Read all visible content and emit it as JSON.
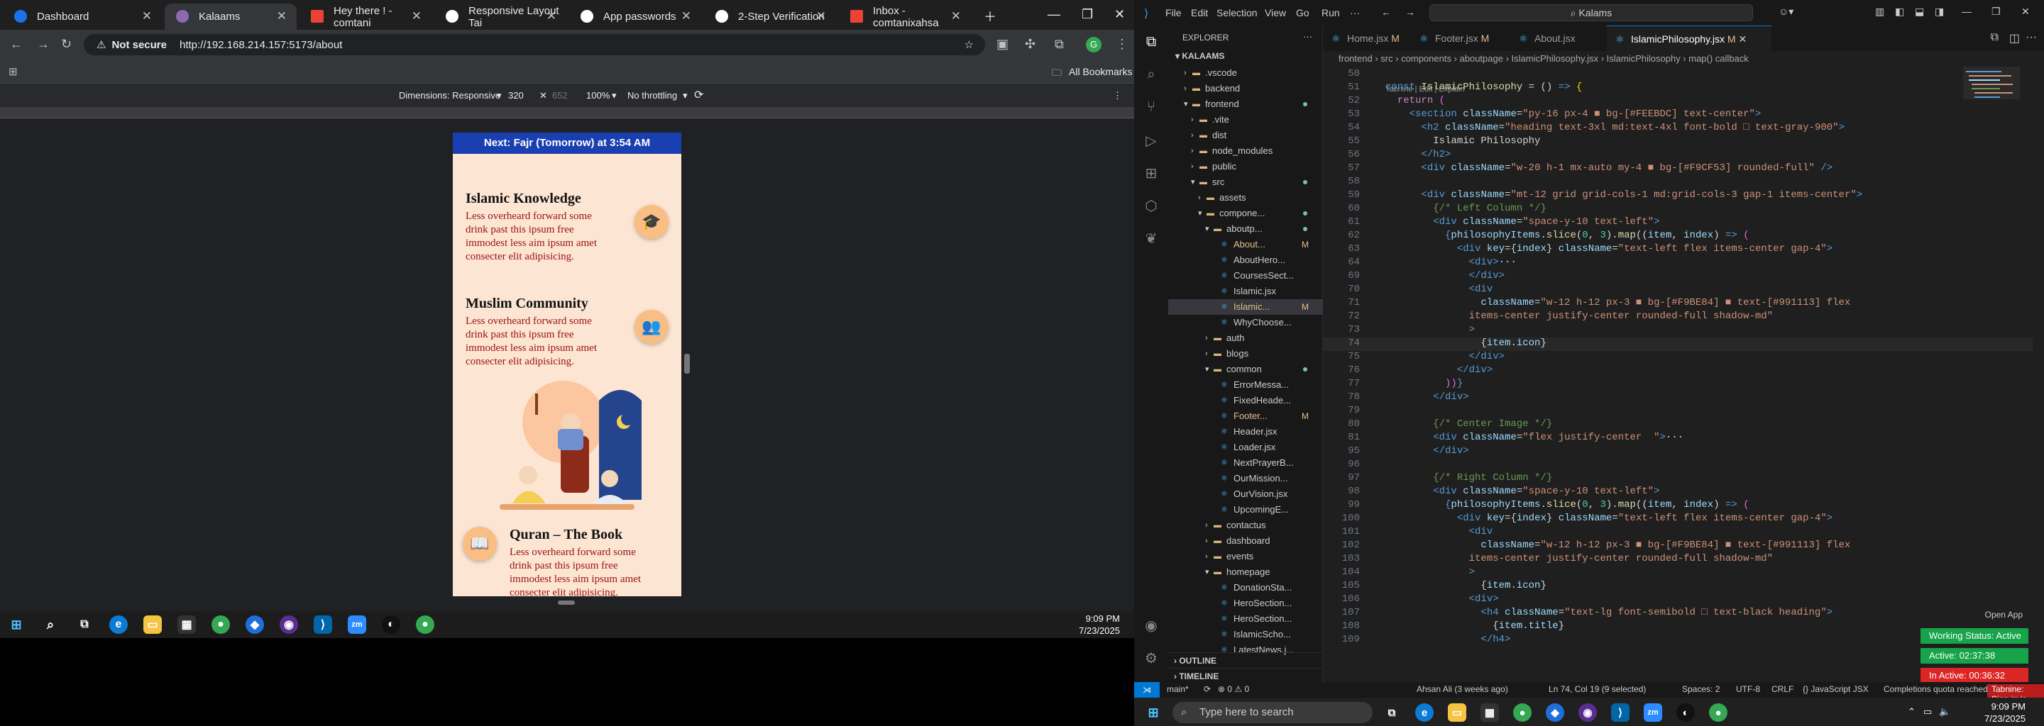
{
  "browser": {
    "tabs": [
      {
        "title": "Dashboard",
        "color": "#1a73e8"
      },
      {
        "title": "Kalaams",
        "color": "#8a6bb0"
      },
      {
        "title": "Hey there ! - comtani",
        "color": "#ea4335"
      },
      {
        "title": "Responsive Layout Tai",
        "color": "#ffffff"
      },
      {
        "title": "App passwords",
        "color": "#ffffff"
      },
      {
        "title": "2-Step Verification",
        "color": "#ffffff"
      },
      {
        "title": "Inbox - comtanixahsa",
        "color": "#ea4335"
      }
    ],
    "not_secure": "Not secure",
    "url": "http://192.168.214.157:5173/about",
    "all_bookmarks": "All Bookmarks",
    "devtools": {
      "dimensions": "Dimensions: Responsive",
      "width": "320",
      "height": "652",
      "zoom": "100%",
      "throttle": "No throttling"
    }
  },
  "mobile": {
    "banner": "Next: Fajr (Tomorrow) at 3:54 AM",
    "items": [
      {
        "title": "Islamic Knowledge",
        "desc": "Less overheard forward some drink past this ipsum free immodest less aim ipsum amet consecter elit adipisicing.",
        "icon": "graduation-cap-icon",
        "glyph": "🎓"
      },
      {
        "title": "Muslim Community",
        "desc": "Less overheard forward some drink past this ipsum free immodest less aim ipsum amet consecter elit adipisicing.",
        "icon": "people-icon",
        "glyph": "👥"
      },
      {
        "title": "Quran – The Book",
        "desc": "Less overheard forward some drink past this ipsum free immodest less aim ipsum amet consecter elit adipisicing.",
        "icon": "book-icon",
        "glyph": "📖"
      }
    ]
  },
  "taskbar_top": {
    "time": "9:09 PM",
    "date": "7/23/2025"
  },
  "vscode": {
    "menu": [
      "File",
      "Edit",
      "Selection",
      "View",
      "Go",
      "Run",
      "···"
    ],
    "search": "Kalams",
    "explorer_title": "EXPLORER",
    "root": "KALAAMS",
    "tree": [
      {
        "label": ".vscode",
        "indent": 1,
        "folder": true,
        "open": false
      },
      {
        "label": "backend",
        "indent": 1,
        "folder": true,
        "open": false
      },
      {
        "label": "frontend",
        "indent": 1,
        "folder": true,
        "open": true,
        "dot": true
      },
      {
        "label": ".vite",
        "indent": 2,
        "folder": true,
        "open": false
      },
      {
        "label": "dist",
        "indent": 2,
        "folder": true,
        "open": false
      },
      {
        "label": "node_modules",
        "indent": 2,
        "folder": true,
        "open": false
      },
      {
        "label": "public",
        "indent": 2,
        "folder": true,
        "open": false
      },
      {
        "label": "src",
        "indent": 2,
        "folder": true,
        "open": true,
        "dot": true
      },
      {
        "label": "assets",
        "indent": 3,
        "folder": true,
        "open": false
      },
      {
        "label": "compone...",
        "indent": 3,
        "folder": true,
        "open": true,
        "dot": true
      },
      {
        "label": "aboutp...",
        "indent": 4,
        "folder": true,
        "open": true,
        "dot": true
      },
      {
        "label": "About...",
        "indent": 5,
        "folder": false,
        "badge": "M"
      },
      {
        "label": "AboutHero...",
        "indent": 5,
        "folder": false
      },
      {
        "label": "CoursesSect...",
        "indent": 5,
        "folder": false
      },
      {
        "label": "Islamic.jsx",
        "indent": 5,
        "folder": false
      },
      {
        "label": "Islamic...",
        "indent": 5,
        "folder": false,
        "badge": "M",
        "selected": true
      },
      {
        "label": "WhyChoose...",
        "indent": 5,
        "folder": false
      },
      {
        "label": "auth",
        "indent": 4,
        "folder": true,
        "open": false
      },
      {
        "label": "blogs",
        "indent": 4,
        "folder": true,
        "open": false
      },
      {
        "label": "common",
        "indent": 4,
        "folder": true,
        "open": true,
        "dot": true
      },
      {
        "label": "ErrorMessa...",
        "indent": 5,
        "folder": false
      },
      {
        "label": "FixedHeade...",
        "indent": 5,
        "folder": false
      },
      {
        "label": "Footer...",
        "indent": 5,
        "folder": false,
        "badge": "M"
      },
      {
        "label": "Header.jsx",
        "indent": 5,
        "folder": false
      },
      {
        "label": "Loader.jsx",
        "indent": 5,
        "folder": false
      },
      {
        "label": "NextPrayerB...",
        "indent": 5,
        "folder": false
      },
      {
        "label": "OurMission...",
        "indent": 5,
        "folder": false
      },
      {
        "label": "OurVision.jsx",
        "indent": 5,
        "folder": false
      },
      {
        "label": "UpcomingE...",
        "indent": 5,
        "folder": false
      },
      {
        "label": "contactus",
        "indent": 4,
        "folder": true,
        "open": false
      },
      {
        "label": "dashboard",
        "indent": 4,
        "folder": true,
        "open": false
      },
      {
        "label": "events",
        "indent": 4,
        "folder": true,
        "open": false
      },
      {
        "label": "homepage",
        "indent": 4,
        "folder": true,
        "open": true
      },
      {
        "label": "DonationSta...",
        "indent": 5,
        "folder": false
      },
      {
        "label": "HeroSection...",
        "indent": 5,
        "folder": false
      },
      {
        "label": "HeroSection...",
        "indent": 5,
        "folder": false
      },
      {
        "label": "IslamicScho...",
        "indent": 5,
        "folder": false
      },
      {
        "label": "LatestNews.j...",
        "indent": 5,
        "folder": false
      }
    ],
    "outline": "OUTLINE",
    "timeline": "TIMELINE",
    "tabs": [
      {
        "label": "Home.jsx",
        "badge": "M"
      },
      {
        "label": "Footer.jsx",
        "badge": "M"
      },
      {
        "label": "About.jsx",
        "badge": ""
      },
      {
        "label": "IslamicPhilosophy.jsx",
        "badge": "M"
      }
    ],
    "breadcrumbs": "frontend  ›  src  ›  components  ›  aboutpage  ›  IslamicPhilosophy.jsx  ›  IslamicPhilosophy  ›  map() callback",
    "tabnine_hint": "Tabnine | Edit | Explain",
    "code": [
      {
        "n": "50",
        "html": ""
      },
      {
        "n": "51",
        "html": "<span class='b'>const</span> <span class='f'>IslamicPhilosophy</span> = () <span class='b'>=&gt;</span> <span class='y'>{</span>"
      },
      {
        "n": "52",
        "html": "  <span class='k'>return</span> <span class='p'>(</span>"
      },
      {
        "n": "53",
        "html": "    <span class='b'>&lt;section</span> <span class='v'>className</span>=<span class='s'>\"py-16 px-4 ■ bg-[#FEEBDC] text-center\"</span><span class='b'>&gt;</span>"
      },
      {
        "n": "54",
        "html": "      <span class='b'>&lt;h2</span> <span class='v'>className</span>=<span class='s'>\"heading text-3xl md:text-4xl font-bold □ text-gray-900\"</span><span class='b'>&gt;</span>"
      },
      {
        "n": "55",
        "html": "        Islamic Philosophy"
      },
      {
        "n": "56",
        "html": "      <span class='b'>&lt;/h2&gt;</span>"
      },
      {
        "n": "57",
        "html": "      <span class='b'>&lt;div</span> <span class='v'>className</span>=<span class='s'>\"w-20 h-1 mx-auto my-4 ■ bg-[#F9CF53] rounded-full\"</span> <span class='b'>/&gt;</span>"
      },
      {
        "n": "58",
        "html": ""
      },
      {
        "n": "59",
        "html": "      <span class='b'>&lt;div</span> <span class='v'>className</span>=<span class='s'>\"mt-12 grid grid-cols-1 md:grid-cols-3 gap-1 items-center\"</span><span class='b'>&gt;</span>"
      },
      {
        "n": "60",
        "html": "        <span class='c'>{/* Left Column */}</span>"
      },
      {
        "n": "61",
        "html": "        <span class='b'>&lt;div</span> <span class='v'>className</span>=<span class='s'>\"space-y-10 text-left\"</span><span class='b'>&gt;</span>"
      },
      {
        "n": "62",
        "html": "          <span class='b'>{</span><span class='v'>philosophyItems</span>.<span class='f'>slice</span>(<span class='t'>0</span>, <span class='t'>3</span>).<span class='f'>map</span>((<span class='v'>item</span>, <span class='v'>index</span>) <span class='b'>=&gt;</span> <span class='p'>(</span>"
      },
      {
        "n": "63",
        "html": "            <span class='b'>&lt;div</span> <span class='v'>key</span>={<span class='v'>index</span>} <span class='v'>className</span>=<span class='s'>\"text-left flex items-center gap-4\"</span><span class='b'>&gt;</span>"
      },
      {
        "n": "64",
        "html": "              <span class='b'>&lt;div&gt;</span>···"
      },
      {
        "n": "69",
        "html": "              <span class='b'>&lt;/div&gt;</span>"
      },
      {
        "n": "70",
        "html": "              <span class='b'>&lt;div</span>"
      },
      {
        "n": "71",
        "html": "                <span class='v'>className</span>=<span class='s'>\"w-12 h-12 px-3 ■ bg-[#F9BE84] ■ text-[#991113] flex</span>"
      },
      {
        "n": "72",
        "html": "<span class='s'>              items-center justify-center rounded-full shadow-md\"</span>"
      },
      {
        "n": "73",
        "html": "              <span class='b'>&gt;</span>"
      },
      {
        "n": "74",
        "html": "                {<span class='v'>item</span>.<span class='v'>icon</span>}"
      },
      {
        "n": "75",
        "html": "              <span class='b'>&lt;/div&gt;</span>"
      },
      {
        "n": "76",
        "html": "            <span class='b'>&lt;/div&gt;</span>"
      },
      {
        "n": "77",
        "html": "          <span class='p'>))</span><span class='b'>}</span>"
      },
      {
        "n": "78",
        "html": "        <span class='b'>&lt;/div&gt;</span>"
      },
      {
        "n": "79",
        "html": ""
      },
      {
        "n": "80",
        "html": "        <span class='c'>{/* Center Image */}</span>"
      },
      {
        "n": "81",
        "html": "        <span class='b'>&lt;div</span> <span class='v'>className</span>=<span class='s'>\"flex justify-center  \"</span><span class='b'>&gt;</span>···"
      },
      {
        "n": "95",
        "html": "        <span class='b'>&lt;/div&gt;</span>"
      },
      {
        "n": "96",
        "html": ""
      },
      {
        "n": "97",
        "html": "        <span class='c'>{/* Right Column */}</span>"
      },
      {
        "n": "98",
        "html": "        <span class='b'>&lt;div</span> <span class='v'>className</span>=<span class='s'>\"space-y-10 text-left\"</span><span class='b'>&gt;</span>"
      },
      {
        "n": "99",
        "html": "          <span class='b'>{</span><span class='v'>philosophyItems</span>.<span class='f'>slice</span>(<span class='t'>0</span>, <span class='t'>3</span>).<span class='f'>map</span>((<span class='v'>item</span>, <span class='v'>index</span>) <span class='b'>=&gt;</span> <span class='p'>(</span>"
      },
      {
        "n": "100",
        "html": "            <span class='b'>&lt;div</span> <span class='v'>key</span>={<span class='v'>index</span>} <span class='v'>className</span>=<span class='s'>\"text-left flex items-center gap-4\"</span><span class='b'>&gt;</span>"
      },
      {
        "n": "101",
        "html": "              <span class='b'>&lt;div</span>"
      },
      {
        "n": "102",
        "html": "                <span class='v'>className</span>=<span class='s'>\"w-12 h-12 px-3 ■ bg-[#F9BE84] ■ text-[#991113] flex</span>"
      },
      {
        "n": "103",
        "html": "<span class='s'>              items-center justify-center rounded-full shadow-md\"</span>"
      },
      {
        "n": "104",
        "html": "              <span class='b'>&gt;</span>"
      },
      {
        "n": "105",
        "html": "                {<span class='v'>item</span>.<span class='v'>icon</span>}"
      },
      {
        "n": "106",
        "html": "              <span class='b'>&lt;div&gt;</span>"
      },
      {
        "n": "107",
        "html": "                <span class='b'>&lt;h4</span> <span class='v'>className</span>=<span class='s'>\"text-lg font-semibold □ text-black heading\"</span><span class='b'>&gt;</span>"
      },
      {
        "n": "108",
        "html": "                  {<span class='v'>item</span>.<span class='v'>title</span>}"
      },
      {
        "n": "109",
        "html": "                <span class='b'>&lt;/h4&gt;</span>"
      }
    ],
    "status": {
      "branch": "main*",
      "errors": "⊗ 0 ⚠ 0",
      "blame": "Ahsan Ali (3 weeks ago)",
      "cursor": "Ln 74, Col 19 (9 selected)",
      "spaces": "Spaces: 2",
      "encoding": "UTF-8",
      "eol": "CRLF",
      "lang": "{} JavaScript JSX",
      "quota": "Completions quota reached",
      "tabnine": "Tabnine: Sign-in is required"
    },
    "open_app": "Open App",
    "pills": [
      {
        "text": "Working Status: Active",
        "color": "#16a34a"
      },
      {
        "text": "Active: 02:37:38",
        "color": "#16a34a"
      },
      {
        "text": "In Active: 00:36:32",
        "color": "#dc2626"
      }
    ]
  },
  "taskbar_bottom": {
    "search_placeholder": "Type here to search",
    "time": "9:09 PM",
    "date": "7/23/2025"
  }
}
